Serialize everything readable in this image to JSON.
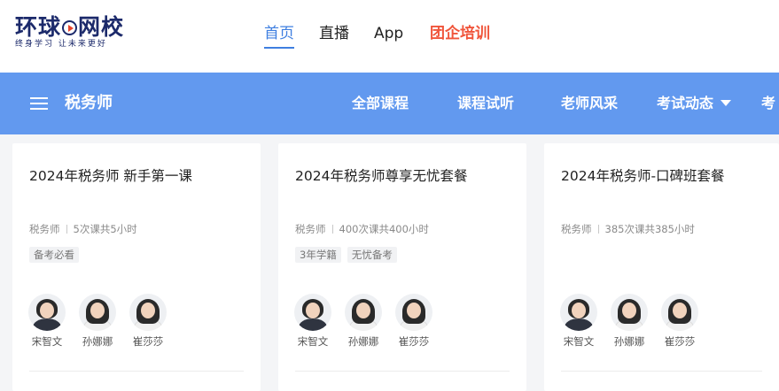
{
  "header": {
    "logo": {
      "main_before": "环球",
      "main_after": "网校",
      "tagline": "终身学习 让未来更好"
    },
    "nav": [
      {
        "label": "首页",
        "active": true
      },
      {
        "label": "直播",
        "active": false
      },
      {
        "label": "App",
        "active": false
      },
      {
        "label": "团企培训",
        "promo": true
      }
    ]
  },
  "category_bar": {
    "title": "税务师",
    "links": [
      "全部课程",
      "课程试听",
      "老师风采",
      "考试动态",
      "考"
    ]
  },
  "colors": {
    "accent": "#3f7fe0",
    "category_bar": "#6299ef",
    "promo": "#f0553b"
  },
  "cards": [
    {
      "title": "2024年税务师 新手第一课",
      "subject": "税务师",
      "lessons": "5次课共5小时",
      "tags": [
        "备考必看"
      ],
      "teachers": [
        "宋智文",
        "孙娜娜",
        "崔莎莎"
      ]
    },
    {
      "title": "2024年税务师尊享无忧套餐",
      "subject": "税务师",
      "lessons": "400次课共400小时",
      "tags": [
        "3年学籍",
        "无忧备考"
      ],
      "teachers": [
        "宋智文",
        "孙娜娜",
        "崔莎莎"
      ]
    },
    {
      "title": "2024年税务师-口碑班套餐",
      "subject": "税务师",
      "lessons": "385次课共385小时",
      "tags": [],
      "teachers": [
        "宋智文",
        "孙娜娜",
        "崔莎莎"
      ]
    }
  ]
}
